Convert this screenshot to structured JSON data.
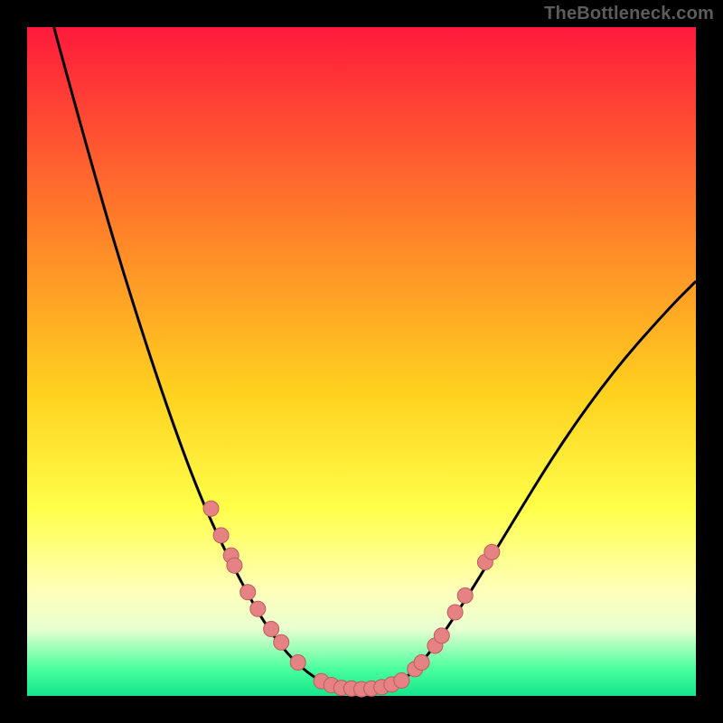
{
  "watermark": "TheBottleneck.com",
  "colors": {
    "background": "#000000",
    "gradient_top": "#ff1a3c",
    "gradient_mid_upper": "#ff7a2a",
    "gradient_mid": "#ffd21f",
    "gradient_mid_lower": "#ffff4a",
    "gradient_lower": "#ffffb8",
    "gradient_bottom1": "#e8ffd0",
    "gradient_bottom2": "#4aff9e",
    "gradient_bottom3": "#14e68c",
    "curve": "#000000",
    "dot_fill": "#e58284",
    "dot_stroke": "#c05b5d"
  },
  "chart_data": {
    "type": "line",
    "title": "",
    "xlabel": "",
    "ylabel": "",
    "xlim": [
      0,
      100
    ],
    "ylim": [
      0,
      100
    ],
    "curves": [
      {
        "name": "bottleneck-v-curve",
        "points": [
          {
            "x": 4,
            "y": 100
          },
          {
            "x": 10,
            "y": 78
          },
          {
            "x": 16,
            "y": 58
          },
          {
            "x": 22,
            "y": 40
          },
          {
            "x": 27,
            "y": 27
          },
          {
            "x": 32,
            "y": 17
          },
          {
            "x": 36,
            "y": 10
          },
          {
            "x": 40,
            "y": 5
          },
          {
            "x": 44,
            "y": 2
          },
          {
            "x": 47,
            "y": 1
          },
          {
            "x": 50,
            "y": 1
          },
          {
            "x": 53,
            "y": 1
          },
          {
            "x": 56,
            "y": 2
          },
          {
            "x": 60,
            "y": 6
          },
          {
            "x": 66,
            "y": 15
          },
          {
            "x": 72,
            "y": 25
          },
          {
            "x": 80,
            "y": 38
          },
          {
            "x": 88,
            "y": 49
          },
          {
            "x": 96,
            "y": 58
          },
          {
            "x": 100,
            "y": 62
          }
        ]
      }
    ],
    "scatter_points": [
      {
        "x": 27.5,
        "y": 28
      },
      {
        "x": 29.0,
        "y": 24
      },
      {
        "x": 30.5,
        "y": 21
      },
      {
        "x": 31.0,
        "y": 19.5
      },
      {
        "x": 33.0,
        "y": 15.5
      },
      {
        "x": 34.5,
        "y": 13
      },
      {
        "x": 36.5,
        "y": 10
      },
      {
        "x": 38.0,
        "y": 8
      },
      {
        "x": 40.5,
        "y": 5
      },
      {
        "x": 44.0,
        "y": 2.2
      },
      {
        "x": 45.5,
        "y": 1.6
      },
      {
        "x": 47.0,
        "y": 1.2
      },
      {
        "x": 48.5,
        "y": 1.1
      },
      {
        "x": 50.0,
        "y": 1.0
      },
      {
        "x": 51.5,
        "y": 1.1
      },
      {
        "x": 53.0,
        "y": 1.3
      },
      {
        "x": 54.5,
        "y": 1.7
      },
      {
        "x": 56.0,
        "y": 2.3
      },
      {
        "x": 58.0,
        "y": 4.0
      },
      {
        "x": 59.0,
        "y": 5.0
      },
      {
        "x": 61.0,
        "y": 7.5
      },
      {
        "x": 62.0,
        "y": 9.0
      },
      {
        "x": 64.0,
        "y": 12.5
      },
      {
        "x": 65.5,
        "y": 15.0
      },
      {
        "x": 68.5,
        "y": 20.0
      },
      {
        "x": 69.5,
        "y": 21.5
      }
    ]
  }
}
